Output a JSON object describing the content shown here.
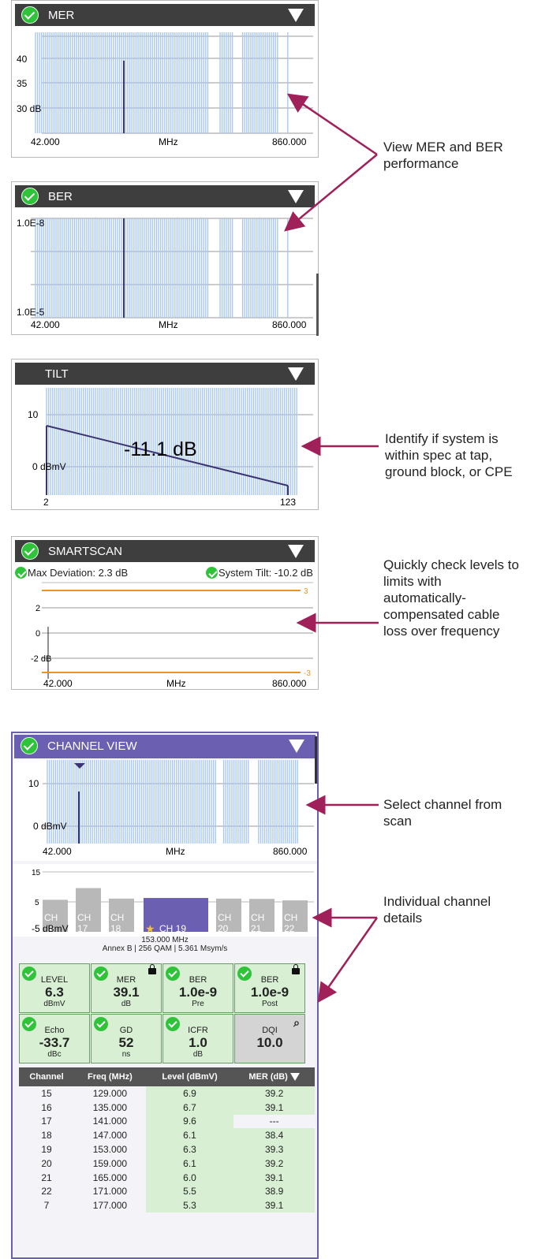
{
  "mer": {
    "title": "MER",
    "y_ticks": [
      "40",
      "35",
      "30 dB"
    ],
    "x_left": "42.000",
    "x_mid": "MHz",
    "x_right": "860.000"
  },
  "ber": {
    "title": "BER",
    "y_top": "1.0E-8",
    "y_bottom": "1.0E-5",
    "x_left": "42.000",
    "x_mid": "MHz",
    "x_right": "860.000"
  },
  "tilt": {
    "title": "TILT",
    "y_ticks": [
      "10",
      "0 dBmV"
    ],
    "x_left": "2",
    "x_right": "123",
    "value": "-11.1 dB"
  },
  "smartscan": {
    "title": "SMARTSCAN",
    "max_deviation": "Max Deviation: 2.3 dB",
    "system_tilt": "System Tilt: -10.2 dB",
    "y_ticks": [
      "2",
      "0",
      "-2 dB"
    ],
    "limit_hi": "3",
    "limit_lo": "-3",
    "x_left": "42.000",
    "x_mid": "MHz",
    "x_right": "860.000"
  },
  "channel_view": {
    "title": "CHANNEL VIEW",
    "scan": {
      "y_ticks": [
        "10",
        "0 dBmV"
      ],
      "x_left": "42.000",
      "x_mid": "MHz",
      "x_right": "860.000"
    },
    "bars_y": [
      "15",
      "5",
      "-5 dBmV"
    ],
    "channels": [
      {
        "line1": "CH",
        "line2": "16",
        "level": 5.7
      },
      {
        "line1": "CH",
        "line2": "17",
        "level": 9.6
      },
      {
        "line1": "CH",
        "line2": "18",
        "level": 6.1
      },
      {
        "line1": "CH",
        "line2": "CH 19",
        "level": 6.3,
        "selected": true
      },
      {
        "line1": "CH",
        "line2": "20",
        "level": 6.1
      },
      {
        "line1": "CH",
        "line2": "21",
        "level": 6.0
      },
      {
        "line1": "CH",
        "line2": "22",
        "level": 5.5
      }
    ],
    "selected_freq": "153.000 MHz",
    "selected_info": "Annex B | 256 QAM | 5.361 Msym/s",
    "tiles": [
      {
        "label": "LEVEL",
        "value": "6.3",
        "unit": "dBmV"
      },
      {
        "label": "MER",
        "value": "39.1",
        "unit": "dB"
      },
      {
        "label": "BER",
        "value": "1.0e-9",
        "unit": "Pre"
      },
      {
        "label": "BER",
        "value": "1.0e-9",
        "unit": "Post"
      },
      {
        "label": "Echo",
        "value": "-33.7",
        "unit": "dBc"
      },
      {
        "label": "GD",
        "value": "52",
        "unit": "ns"
      },
      {
        "label": "ICFR",
        "value": "1.0",
        "unit": "dB"
      },
      {
        "label": "DQI",
        "value": "10.0",
        "unit": ""
      }
    ],
    "table": {
      "headers": [
        "Channel",
        "Freq (MHz)",
        "Level (dBmV)",
        "MER (dB)"
      ],
      "rows": [
        [
          "15",
          "129.000",
          "6.9",
          "39.2"
        ],
        [
          "16",
          "135.000",
          "6.7",
          "39.1"
        ],
        [
          "17",
          "141.000",
          "9.6",
          "---"
        ],
        [
          "18",
          "147.000",
          "6.1",
          "38.4"
        ],
        [
          "19",
          "153.000",
          "6.3",
          "39.3"
        ],
        [
          "20",
          "159.000",
          "6.1",
          "39.2"
        ],
        [
          "21",
          "165.000",
          "6.0",
          "39.1"
        ],
        [
          "22",
          "171.000",
          "5.5",
          "38.9"
        ],
        [
          "7",
          "177.000",
          "5.3",
          "39.1"
        ]
      ]
    }
  },
  "annotations": {
    "mer_ber": "View MER and BER performance",
    "tilt": "Identify if system is within spec at tap, ground block, or CPE",
    "smartscan": "Quickly check levels to limits with automatically-compensated cable loss over frequency",
    "select": "Select channel from scan",
    "details": "Individual channel details"
  },
  "colors": {
    "header": "#3e3e3e",
    "check": "#2fc33a",
    "bar": "#a9c8f0",
    "selected": "#6a5fb0",
    "arrow": "#a0205a",
    "limit": "#f0921e",
    "channel_frame": "#6a5fb0"
  }
}
